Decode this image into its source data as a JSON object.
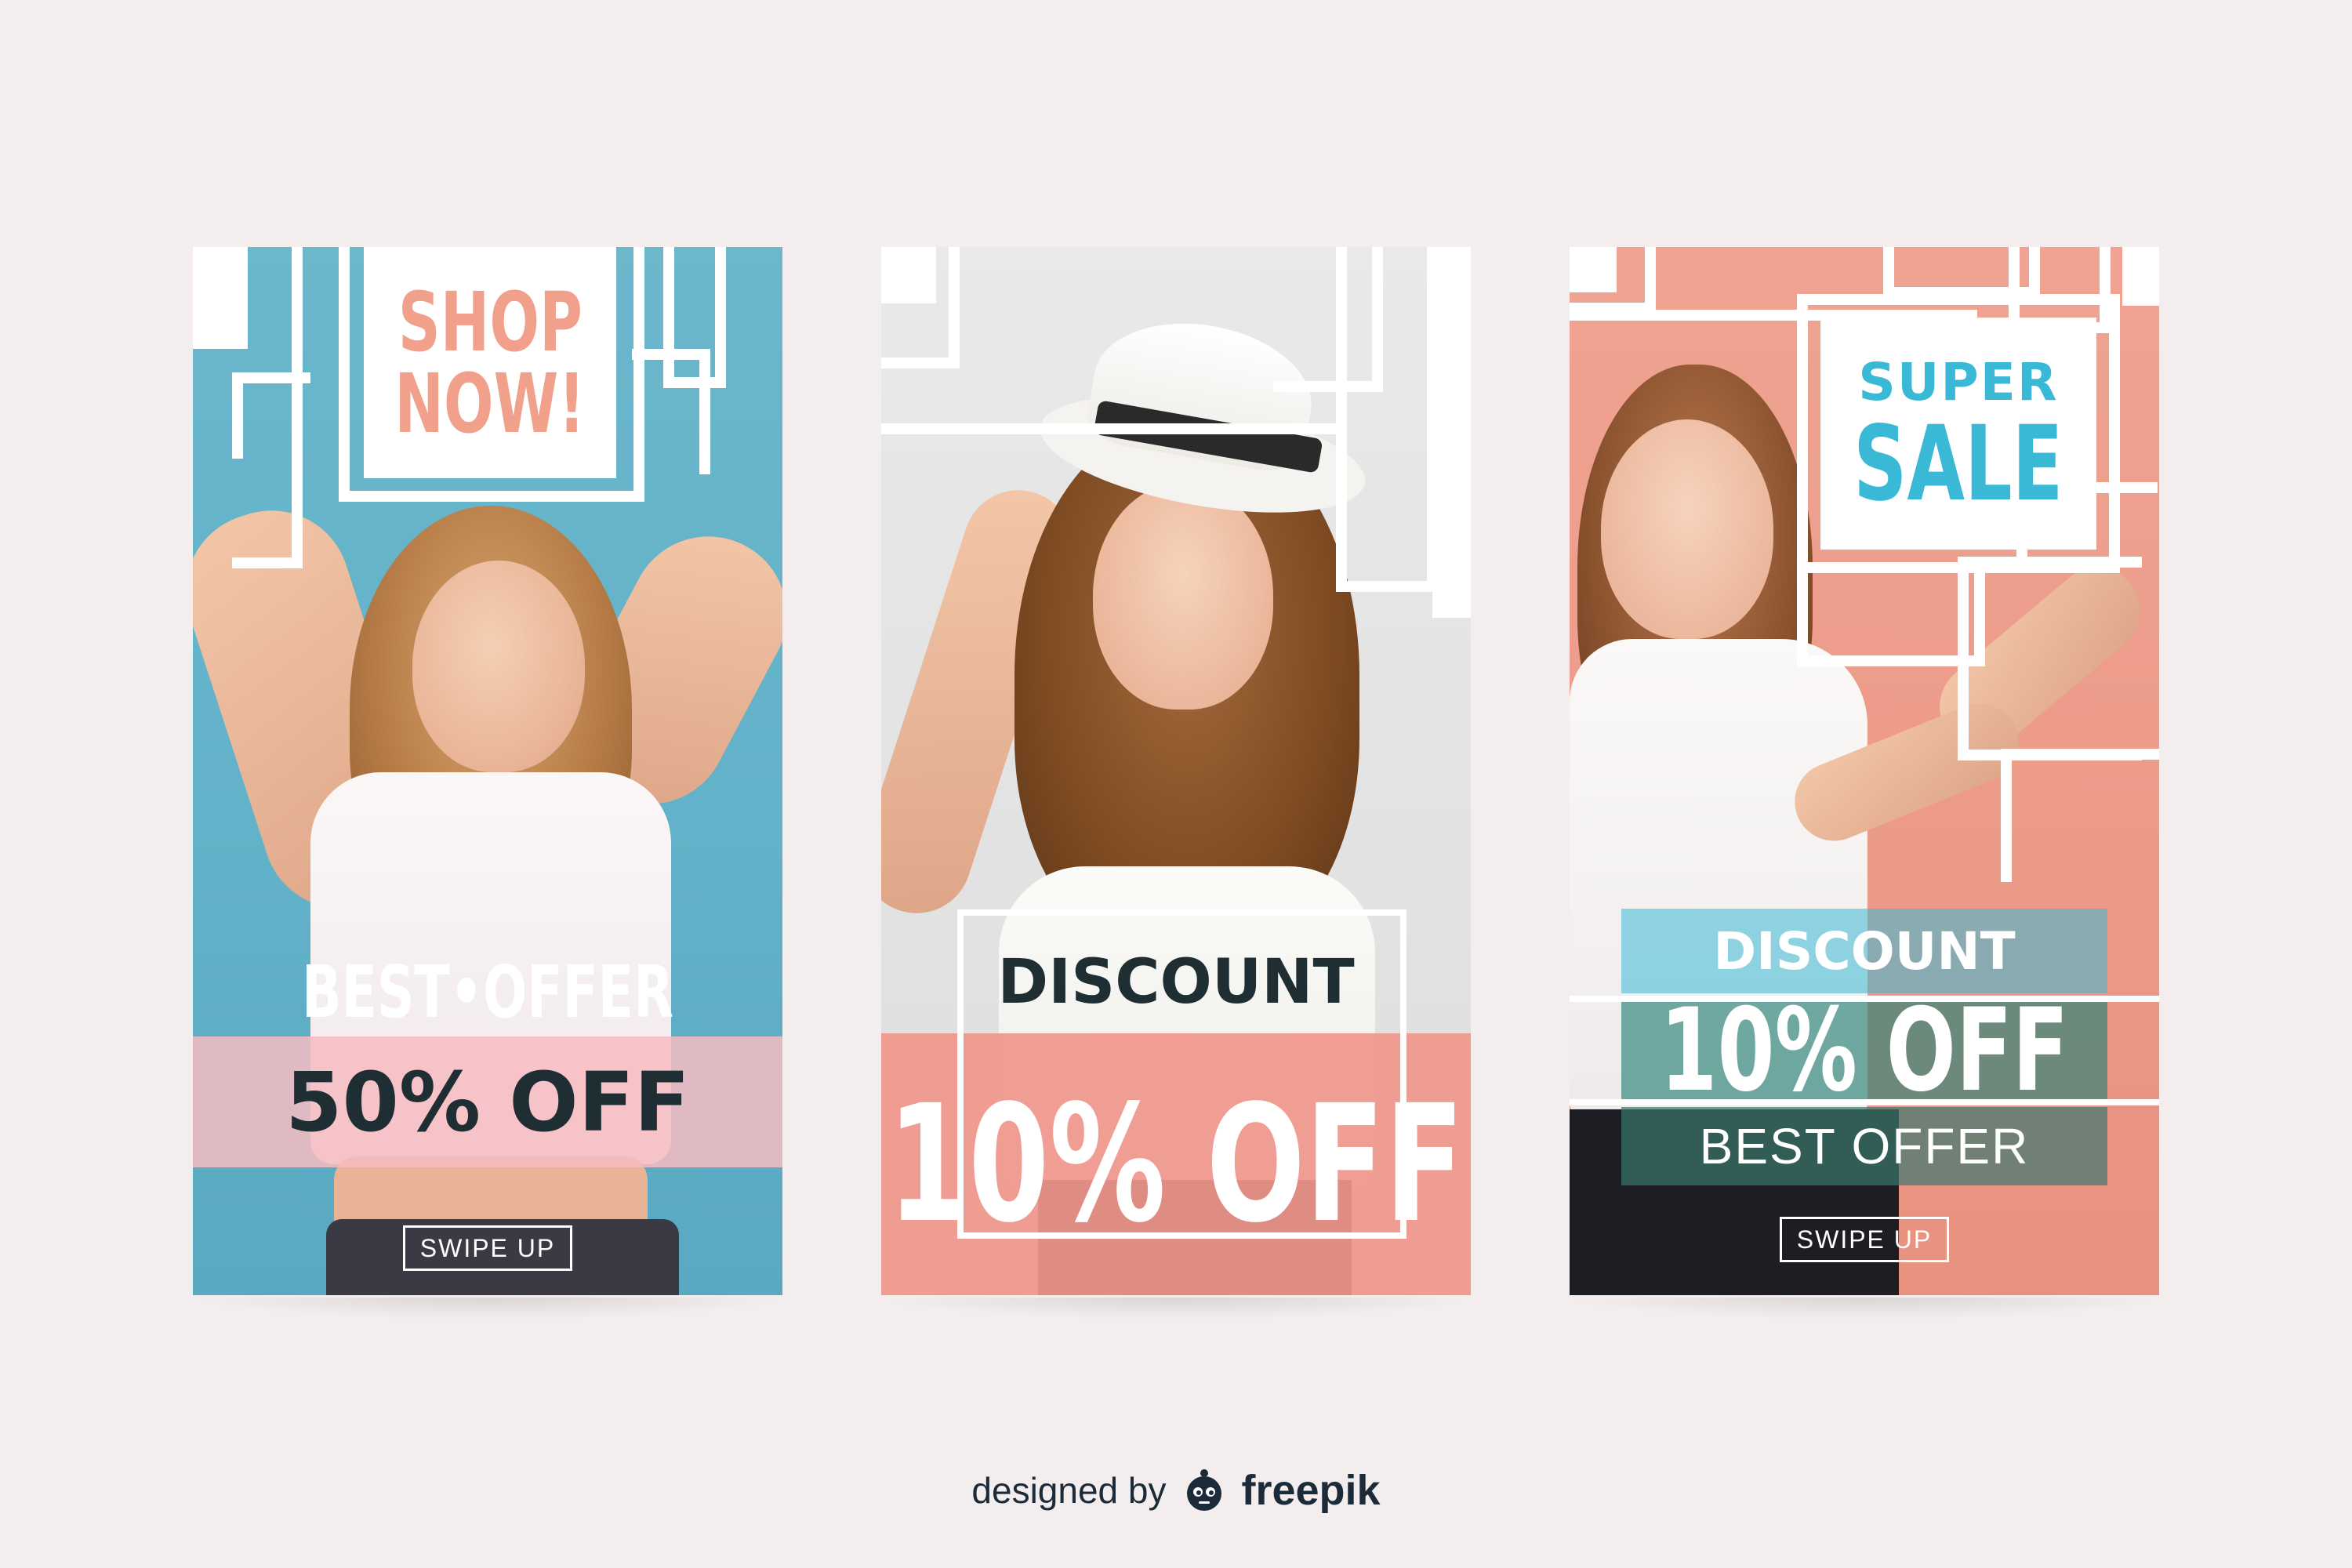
{
  "colors": {
    "background": "#f3eded",
    "card1_bg": "#62b2c9",
    "card2_bg": "#e2e2e2",
    "card3_bg": "#ec9a88",
    "peach": "#f1a08c",
    "cyan": "#3ab9d6",
    "dark_text": "#1f2e33",
    "white": "#ffffff"
  },
  "cards": [
    {
      "headline": [
        "SHOP",
        "NOW!"
      ],
      "subline": "BEST•OFFER",
      "offer": "50% OFF",
      "cta": "SWIPE UP"
    },
    {
      "label": "DISCOUNT",
      "offer": "10% OFF"
    },
    {
      "headline": [
        "SUPER",
        "SALE"
      ],
      "label": "DISCOUNT",
      "offer": "10% OFF",
      "subline": "BEST OFFER",
      "cta": "SWIPE UP"
    }
  ],
  "footer": {
    "designed_by": "designed by",
    "brand": "freepik",
    "logo_icon": "freepik-logo-icon"
  }
}
